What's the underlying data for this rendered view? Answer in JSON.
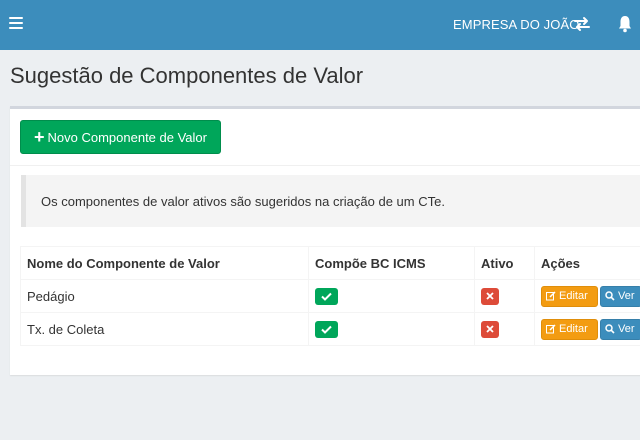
{
  "header": {
    "company": "EMPRESA DO JOÃO",
    "icons": [
      "menu-icon",
      "swap-icon",
      "bell-icon"
    ],
    "bar_color": "#3c8dbc"
  },
  "page": {
    "title": "Sugestão de Componentes de Valor"
  },
  "toolbar": {
    "new_button_label": "Novo Componente de Valor",
    "new_button_icon": "plus-icon"
  },
  "callout": {
    "text": "Os componentes de valor ativos são sugeridos na criação de um CTe."
  },
  "table": {
    "headers": [
      "Nome do Componente de Valor",
      "Compõe BC ICMS",
      "Ativo",
      "Ações"
    ],
    "rows": [
      {
        "name": "Pedágio",
        "compoe_bc_icms": true,
        "ativo": false
      },
      {
        "name": "Tx. de Coleta",
        "compoe_bc_icms": true,
        "ativo": false
      }
    ],
    "actions": {
      "edit_label": "Editar",
      "view_label": "Ver"
    }
  },
  "colors": {
    "success": "#00a65a",
    "danger": "#dd4b39",
    "warning": "#f39c12",
    "primary": "#3c8dbc"
  }
}
